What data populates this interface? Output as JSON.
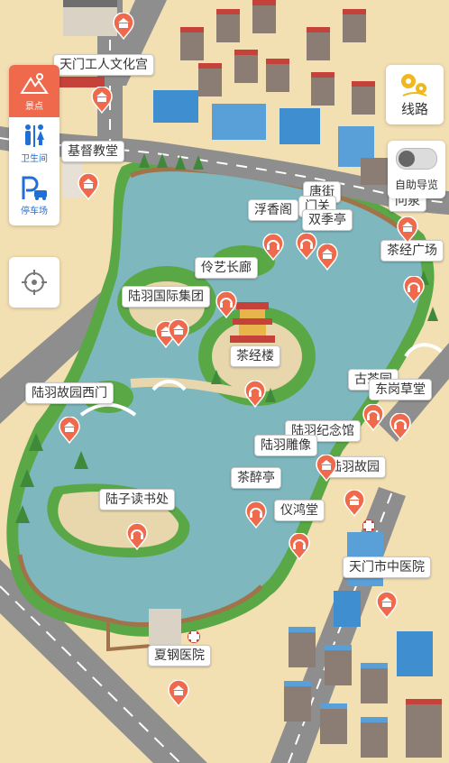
{
  "side_panel": {
    "items": [
      {
        "label": "景点",
        "icon": "scenic-icon",
        "active": true
      },
      {
        "label": "卫生间",
        "icon": "restroom-icon",
        "active": false
      },
      {
        "label": "停车场",
        "icon": "parking-icon",
        "active": false
      }
    ]
  },
  "locate": {
    "icon": "crosshair-icon"
  },
  "route_button": {
    "label": "线路",
    "icon": "route-icon"
  },
  "auto_guide": {
    "label": "自助导览",
    "enabled": false
  },
  "colors": {
    "accent": "#ef6a4c",
    "lake": "#7fb7bf",
    "shore": "#5aa845",
    "road": "#8e8e8e",
    "ground": "#f2dfb2",
    "icon_blue": "#1f6fd6"
  },
  "labels": [
    {
      "id": "wenhuagong",
      "text": "天门工人文化宫"
    },
    {
      "id": "jidu",
      "text": "基督教堂"
    },
    {
      "id": "tangjie",
      "text": "唐街"
    },
    {
      "id": "menyuan",
      "text": "门关"
    },
    {
      "id": "fuxiangge",
      "text": "浮香阁"
    },
    {
      "id": "shuangjiting",
      "text": "双季亭"
    },
    {
      "id": "wenquan",
      "text": "问泉"
    },
    {
      "id": "chajing",
      "text": "茶经广场"
    },
    {
      "id": "lingyi",
      "text": "伶艺长廊"
    },
    {
      "id": "luyujituan",
      "text": "陆羽国际集团"
    },
    {
      "id": "chajinglou",
      "text": "茶经楼"
    },
    {
      "id": "gushiyuan",
      "text": "古茶园"
    },
    {
      "id": "donggang",
      "text": "东岗草堂"
    },
    {
      "id": "xixmen",
      "text": "陆羽故园西门"
    },
    {
      "id": "jinianguan",
      "text": "陆羽纪念馆"
    },
    {
      "id": "diaoxiang",
      "text": "陆羽雕像"
    },
    {
      "id": "guyuan",
      "text": "陆羽故园"
    },
    {
      "id": "chazuiting",
      "text": "茶醉亭"
    },
    {
      "id": "shuchu",
      "text": "陆子读书处"
    },
    {
      "id": "yihongtang",
      "text": "仪鸿堂"
    },
    {
      "id": "zhongyiyuan",
      "text": "天门市中医院"
    },
    {
      "id": "xiagang",
      "text": "夏钢医院"
    }
  ],
  "pins": [
    {
      "id": "wenhuagong",
      "kind": "temple"
    },
    {
      "id": "jidu-a",
      "kind": "temple"
    },
    {
      "id": "jidu-b",
      "kind": "temple"
    },
    {
      "id": "fuxiangge",
      "kind": "audio"
    },
    {
      "id": "shuangjiting",
      "kind": "audio"
    },
    {
      "id": "tangjie",
      "kind": "temple"
    },
    {
      "id": "wenquan",
      "kind": "temple"
    },
    {
      "id": "chajing",
      "kind": "audio"
    },
    {
      "id": "lingyi",
      "kind": "audio"
    },
    {
      "id": "luyujituan-a",
      "kind": "temple"
    },
    {
      "id": "luyujituan-b",
      "kind": "temple"
    },
    {
      "id": "chajinglou",
      "kind": "audio"
    },
    {
      "id": "gushiyuan",
      "kind": "audio"
    },
    {
      "id": "donggang",
      "kind": "audio"
    },
    {
      "id": "xixmen",
      "kind": "temple"
    },
    {
      "id": "guyuan",
      "kind": "temple"
    },
    {
      "id": "chazuiting",
      "kind": "temple"
    },
    {
      "id": "diaoxiang",
      "kind": "audio"
    },
    {
      "id": "shuchu",
      "kind": "audio"
    },
    {
      "id": "yihongtang",
      "kind": "audio"
    },
    {
      "id": "zhongyiyuan",
      "kind": "temple"
    },
    {
      "id": "xiagang",
      "kind": "temple"
    }
  ]
}
